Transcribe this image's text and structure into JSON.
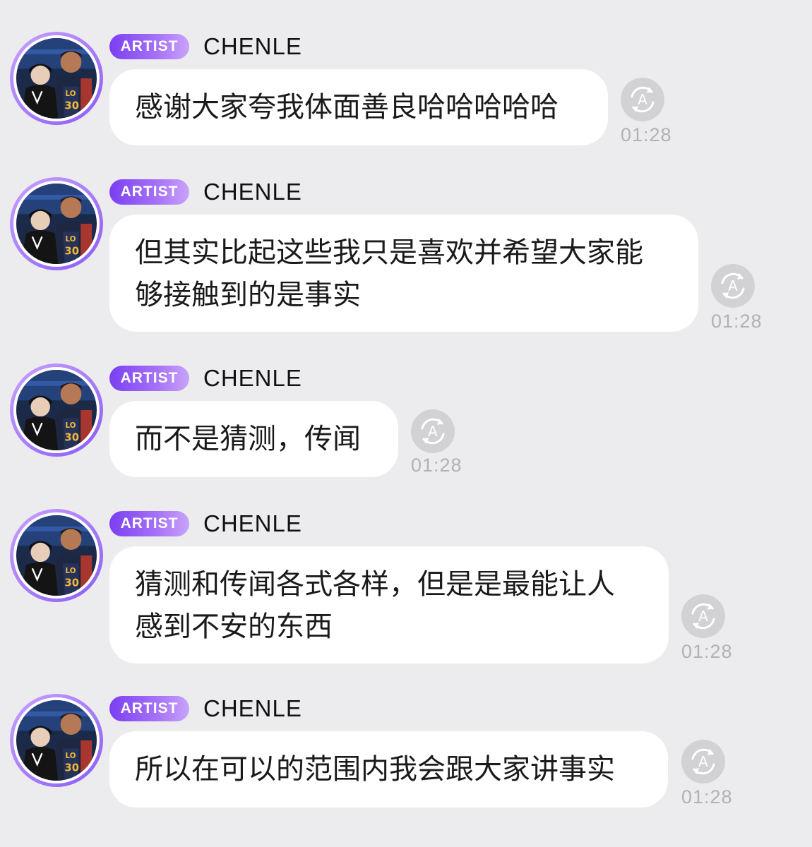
{
  "badge_label": "ARTIST",
  "sender_name": "CHENLE",
  "colors": {
    "background": "#ececee",
    "bubble": "#ffffff",
    "badge_start": "#7b3ff2",
    "badge_end": "#c9a3fa",
    "avatar_ring": "#a67cf7",
    "timestamp": "#b2b2b2"
  },
  "messages": [
    {
      "line1": "感谢大家夸我体面善良哈哈哈哈哈",
      "line2": "",
      "time": "01:28",
      "translate_icon": "translate-icon"
    },
    {
      "line1": "但其实比起这些我只是喜欢并希望大家能",
      "line2": "够接触到的是事实",
      "time": "01:28",
      "translate_icon": "translate-icon"
    },
    {
      "line1": "而不是猜测，传闻",
      "line2": "",
      "time": "01:28",
      "translate_icon": "translate-icon"
    },
    {
      "line1": "猜测和传闻各式各样，但是是最能让人",
      "line2": "感到不安的东西",
      "time": "01:28",
      "translate_icon": "translate-icon"
    },
    {
      "line1": "所以在可以的范围内我会跟大家讲事实",
      "line2": "",
      "time": "01:28",
      "translate_icon": "translate-icon"
    }
  ]
}
